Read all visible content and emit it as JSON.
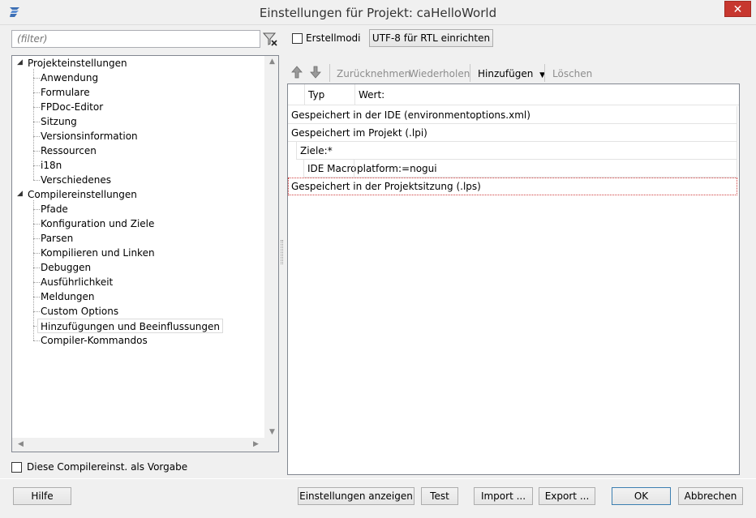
{
  "window": {
    "title": "Einstellungen für Projekt: caHelloWorld",
    "close_label": "✕"
  },
  "filter": {
    "placeholder": "(filter)"
  },
  "tree": {
    "groups": [
      {
        "label": "Projekteinstellungen",
        "children": [
          "Anwendung",
          "Formulare",
          "FPDoc-Editor",
          "Sitzung",
          "Versionsinformation",
          "Ressourcen",
          "i18n",
          "Verschiedenes"
        ]
      },
      {
        "label": "Compilereinstellungen",
        "children": [
          "Pfade",
          "Konfiguration und Ziele",
          "Parsen",
          "Kompilieren und Linken",
          "Debuggen",
          "Ausführlichkeit",
          "Meldungen",
          "Custom Options",
          "Hinzufügungen und Beeinflussungen",
          "Compiler-Kommandos"
        ]
      }
    ],
    "selected": "Hinzufügungen und Beeinflussungen"
  },
  "default_checkbox": {
    "label": "Diese Compilereinst. als Vorgabe",
    "checked": false
  },
  "top_controls": {
    "buildmodes_label": "Erstellmodi",
    "buildmodes_checked": false,
    "utf8_button": "UTF-8 für RTL einrichten"
  },
  "toolbar": {
    "undo": "Zurücknehmen",
    "redo": "Wiederholen",
    "add": "Hinzufügen",
    "delete": "Löschen"
  },
  "grid": {
    "headers": {
      "type": "Typ",
      "value": "Wert:"
    },
    "rows": {
      "ide": "Gespeichert in der IDE (environmentoptions.xml)",
      "project": "Gespeichert im Projekt (.lpi)",
      "targets": "Ziele:*",
      "macro_type": "IDE Macro",
      "macro_value": "platform:=nogui",
      "session": "Gespeichert in der Projektsitzung (.lps)"
    }
  },
  "bottom_buttons": {
    "help": "Hilfe",
    "show_options": "Einstellungen anzeigen",
    "test": "Test",
    "import": "Import ...",
    "export": "Export ...",
    "ok": "OK",
    "cancel": "Abbrechen"
  },
  "colors": {
    "close_button": "#c7372f",
    "session_row_border": "#d04040",
    "default_button_border": "#3c7fb1"
  }
}
